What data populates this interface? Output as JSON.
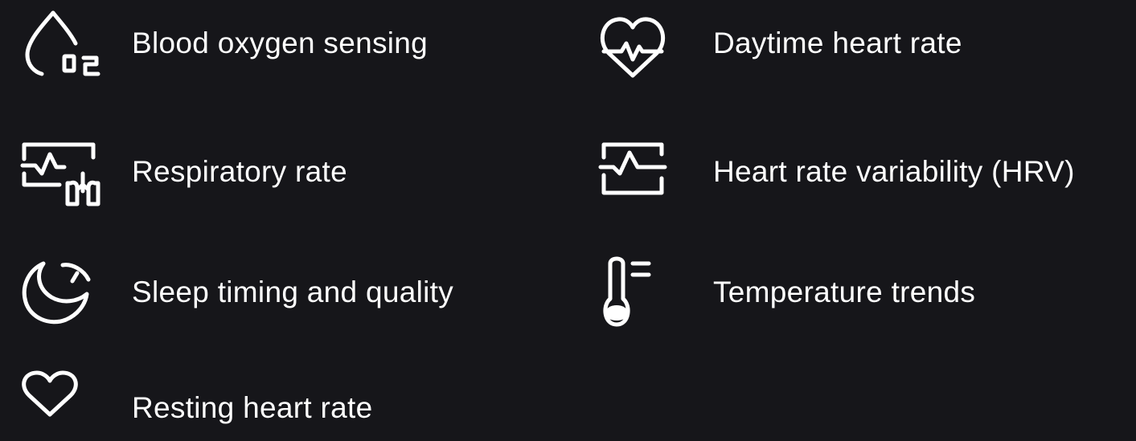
{
  "features": {
    "blood_oxygen": {
      "label": "Blood oxygen sensing",
      "icon": "blood-oxygen-icon"
    },
    "daytime_heart_rate": {
      "label": "Daytime heart rate",
      "icon": "heart-pulse-icon"
    },
    "respiratory_rate": {
      "label": "Respiratory rate",
      "icon": "lungs-monitor-icon"
    },
    "hrv": {
      "label": "Heart rate variability (HRV)",
      "icon": "pulse-monitor-icon"
    },
    "sleep": {
      "label": "Sleep timing and quality",
      "icon": "moon-icon"
    },
    "temperature": {
      "label": "Temperature trends",
      "icon": "thermometer-icon"
    },
    "resting_heart_rate": {
      "label": "Resting heart rate",
      "icon": "heart-icon"
    }
  },
  "colors": {
    "background": "#16161a",
    "foreground": "#ffffff"
  }
}
